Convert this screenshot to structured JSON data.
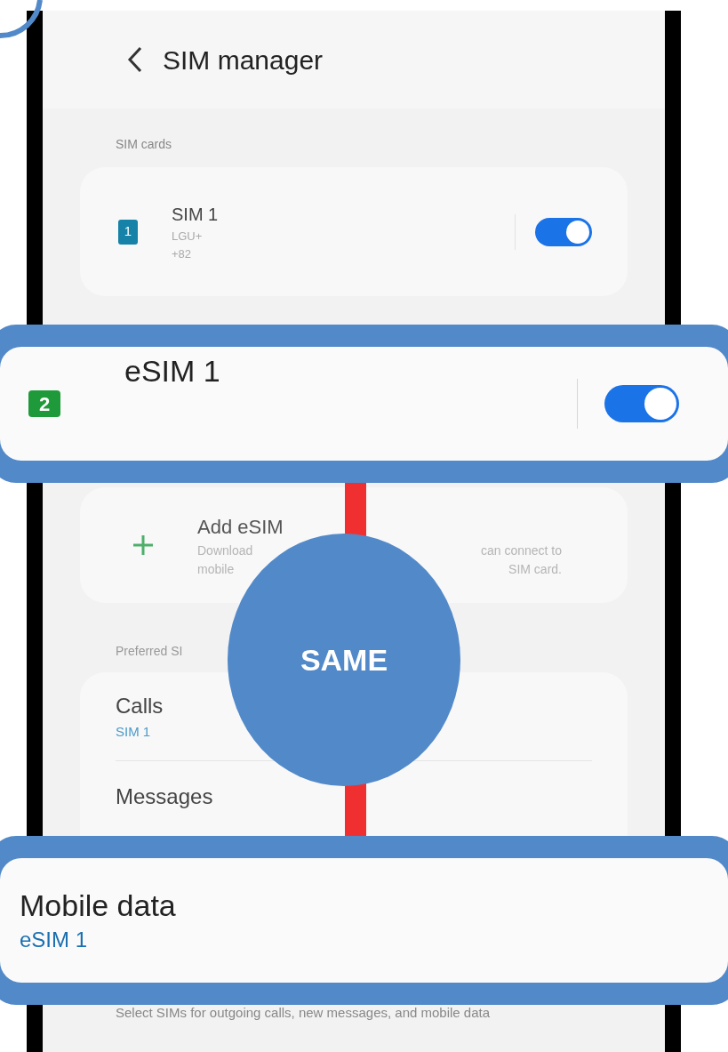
{
  "header": {
    "title": "SIM manager"
  },
  "sim_cards": {
    "heading": "SIM cards",
    "items": [
      {
        "name": "SIM 1",
        "badge": "1",
        "carrier": "LGU+",
        "number": "+82",
        "on": true
      }
    ]
  },
  "add_esim": {
    "title": "Add eSIM",
    "desc_lines": [
      [
        "Download",
        "can connect to"
      ],
      [
        "mobile",
        "SIM card."
      ]
    ]
  },
  "preferred": {
    "heading": "Preferred SI",
    "items": [
      {
        "label": "Calls",
        "value": "SIM 1"
      },
      {
        "label": "Messages"
      }
    ]
  },
  "footer_note": "Select SIMs for outgoing calls, new messages, and mobile data",
  "callouts": [
    {
      "kind": "esim",
      "name": "eSIM 1",
      "badge": "2",
      "on": true
    },
    {
      "kind": "pref",
      "label": "Mobile data",
      "value": "eSIM 1"
    }
  ],
  "connector": {
    "label": "SAME"
  }
}
